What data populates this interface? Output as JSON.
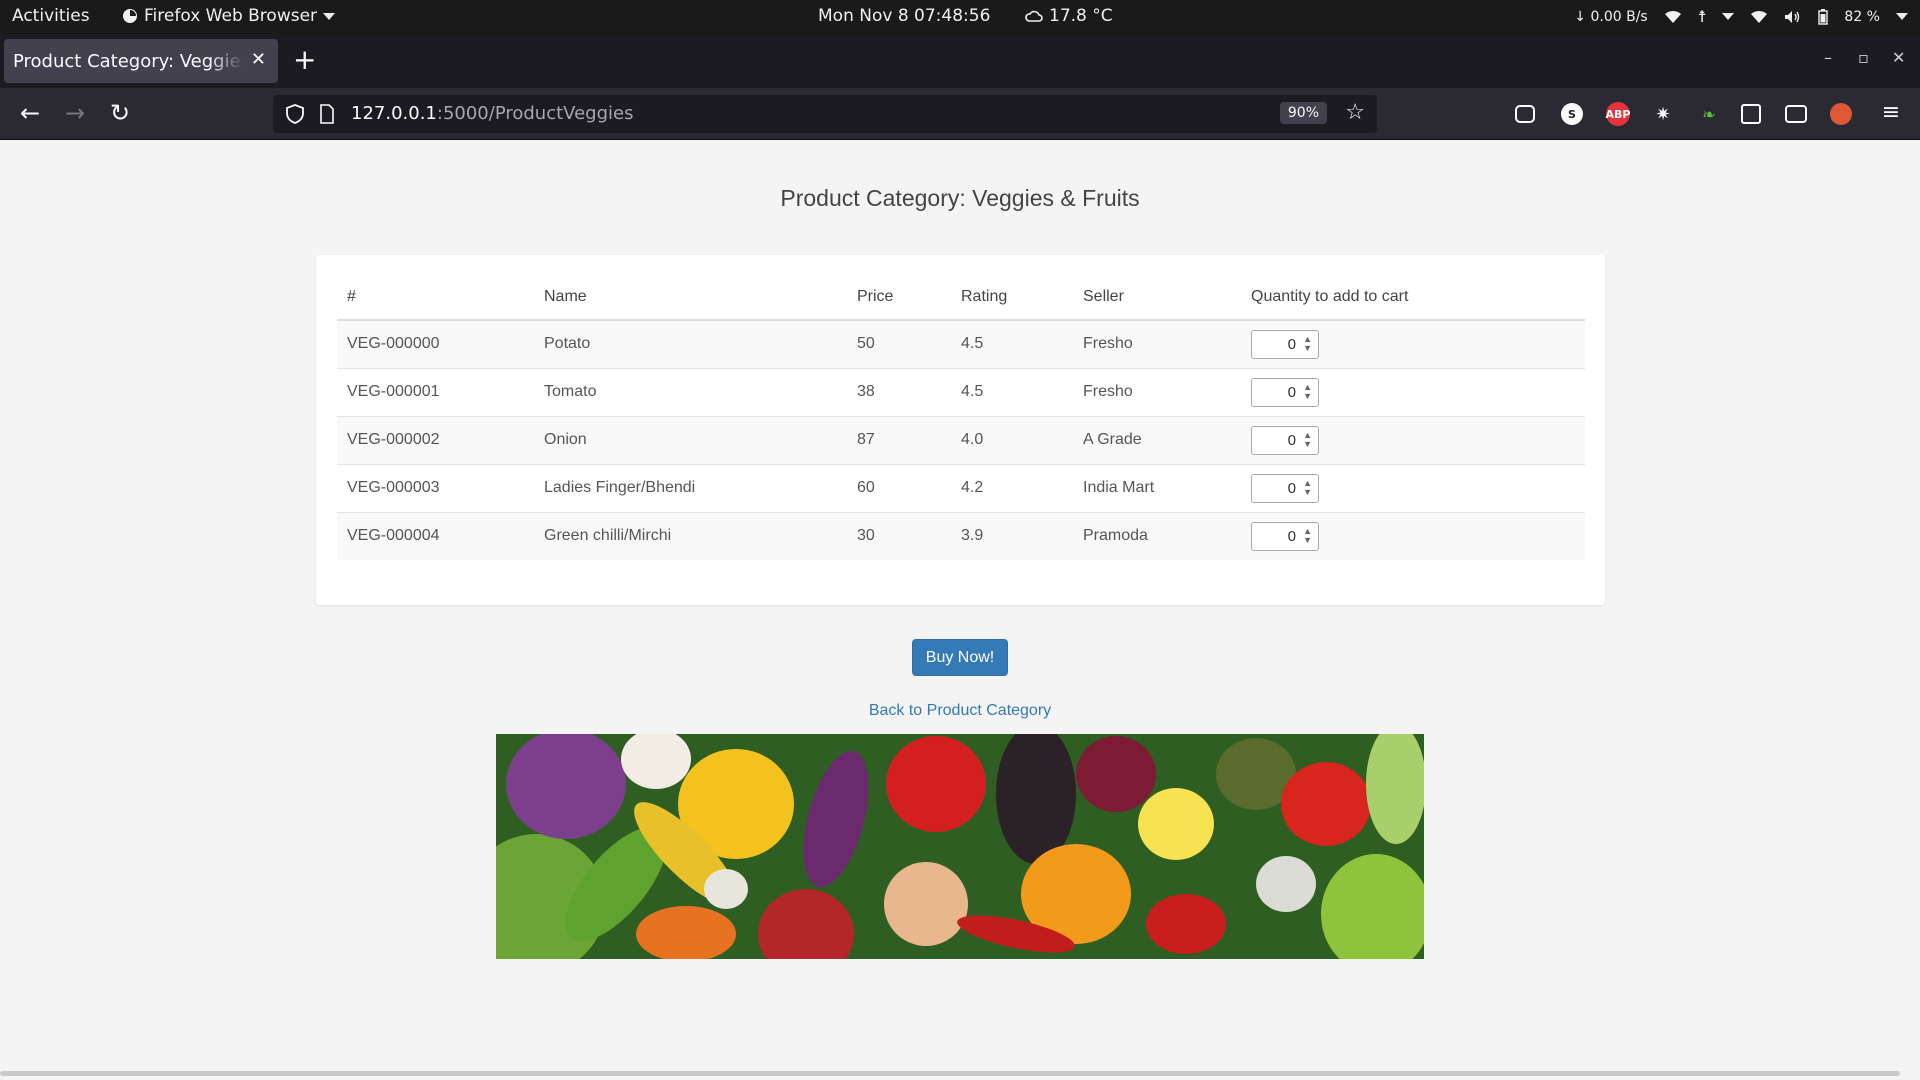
{
  "system": {
    "activities": "Activities",
    "app_name": "Firefox Web Browser",
    "clock": "Mon Nov 8  07:48:56",
    "weather": "17.8 °C",
    "net_speed": "↓ 0.00 B/s",
    "battery": "82 %"
  },
  "browser": {
    "tab_title": "Product Category: Veggies & Fruits",
    "url_host": "127.0.0.1",
    "url_rest": ":5000/ProductVeggies",
    "zoom": "90%",
    "extensions": [
      "pocket-icon",
      "s-icon",
      "adblock-plus-icon",
      "paw-icon",
      "pet-icon",
      "reader-icon",
      "glasses-icon",
      "duckduckgo-icon",
      "menu-icon"
    ]
  },
  "page": {
    "title": "Product Category: Veggies & Fruits",
    "table": {
      "headers": [
        "#",
        "Name",
        "Price",
        "Rating",
        "Seller",
        "Quantity to add to cart"
      ],
      "rows": [
        {
          "id": "VEG-000000",
          "name": "Potato",
          "price": "50",
          "rating": "4.5",
          "seller": "Fresho",
          "qty": "0"
        },
        {
          "id": "VEG-000001",
          "name": "Tomato",
          "price": "38",
          "rating": "4.5",
          "seller": "Fresho",
          "qty": "0"
        },
        {
          "id": "VEG-000002",
          "name": "Onion",
          "price": "87",
          "rating": "4.0",
          "seller": "A Grade",
          "qty": "0"
        },
        {
          "id": "VEG-000003",
          "name": "Ladies Finger/Bhendi",
          "price": "60",
          "rating": "4.2",
          "seller": "India Mart",
          "qty": "0"
        },
        {
          "id": "VEG-000004",
          "name": "Green chilli/Mirchi",
          "price": "30",
          "rating": "3.9",
          "seller": "Pramoda",
          "qty": "0"
        }
      ]
    },
    "buy_button": "Buy Now!",
    "back_link": "Back to Product Category",
    "banner_image": "vegetables-banner"
  },
  "colors": {
    "primary": "#337ab7",
    "browser_bg": "#1c1b22",
    "page_bg": "#f4f4f4"
  }
}
